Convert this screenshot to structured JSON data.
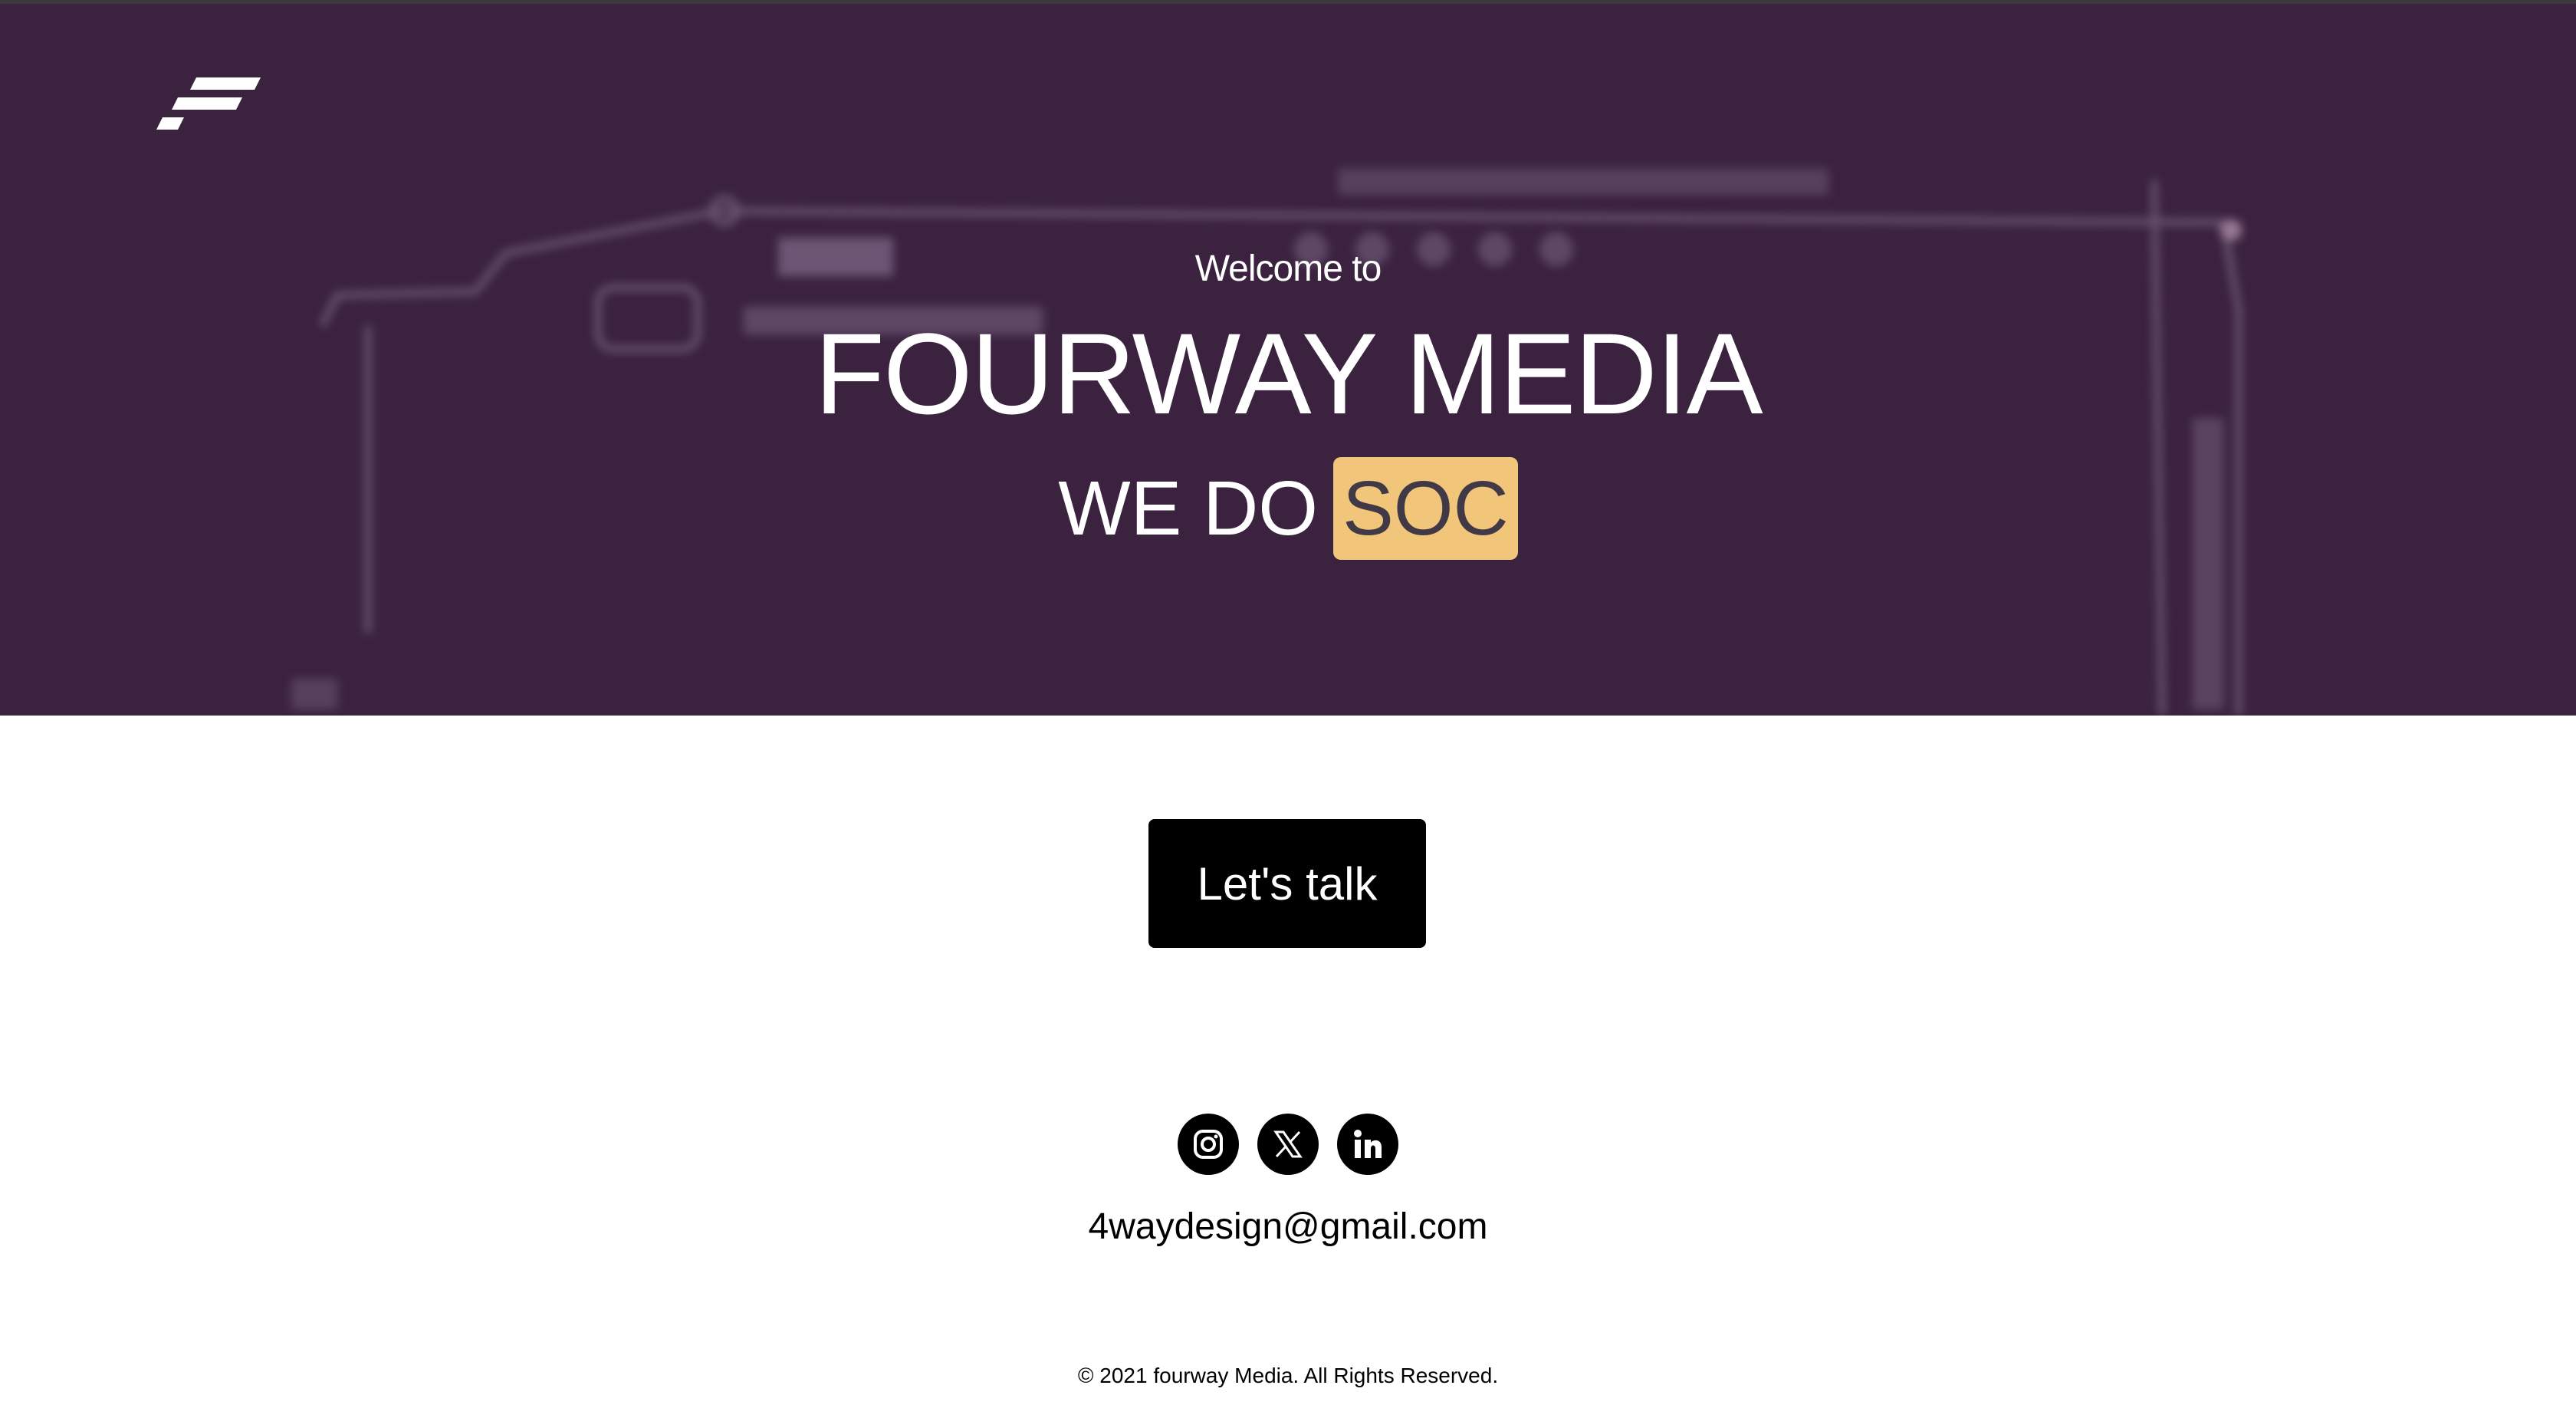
{
  "hero": {
    "welcome": "Welcome to",
    "brand": "FOURWAY MEDIA",
    "tagline_prefix": "WE DO",
    "tagline_highlight": "SOC"
  },
  "cta": {
    "label": "Let's talk"
  },
  "socials": [
    {
      "name": "instagram",
      "icon": "instagram-icon"
    },
    {
      "name": "x",
      "icon": "x-icon"
    },
    {
      "name": "linkedin",
      "icon": "linkedin-icon"
    }
  ],
  "contact": {
    "email": "4waydesign@gmail.com"
  },
  "footer": {
    "copyright": "© 2021 fourway Media. All Rights Reserved."
  },
  "colors": {
    "hero_bg": "#3b2340",
    "highlight_bg": "#f1c57a",
    "highlight_text": "#413a46",
    "button_bg": "#000000",
    "text_light": "#ffffff"
  }
}
